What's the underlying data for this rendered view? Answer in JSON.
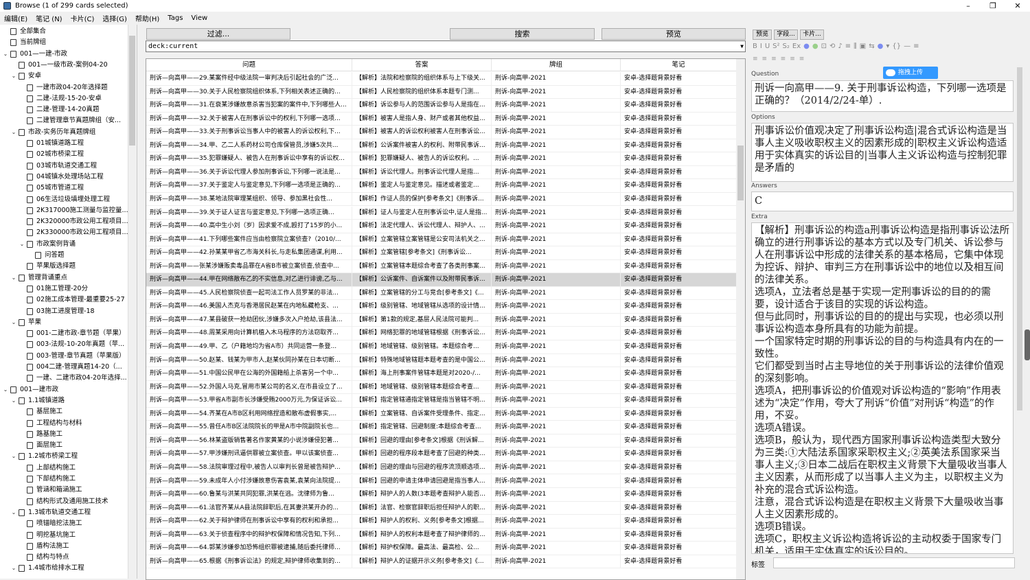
{
  "window": {
    "title": "Browse (1 of 299 cards selected)",
    "controls": [
      "–",
      "❐",
      "✕"
    ]
  },
  "menu": [
    "编辑(E)",
    "笔记 (N)",
    "卡片(C)",
    "选择(G)",
    "帮助(H)",
    "Tags",
    "View"
  ],
  "sidebar": [
    {
      "d": 0,
      "exp": "",
      "label": "全部集合",
      "icon": "stack"
    },
    {
      "d": 0,
      "exp": "",
      "label": "当前牌组",
      "icon": "card"
    },
    {
      "d": 0,
      "exp": "v",
      "label": "001—一建-市政",
      "icon": "card"
    },
    {
      "d": 1,
      "exp": "",
      "label": "001—一级市政-案例04-20",
      "icon": "card"
    },
    {
      "d": 1,
      "exp": "v",
      "label": "安卓",
      "icon": "card"
    },
    {
      "d": 2,
      "exp": "",
      "label": "一建市政04-20年选择题",
      "icon": "card"
    },
    {
      "d": 2,
      "exp": "",
      "label": "二建-法规-15-20-安卓",
      "icon": "card"
    },
    {
      "d": 2,
      "exp": "",
      "label": "二建-管理-14-20真题",
      "icon": "card"
    },
    {
      "d": 2,
      "exp": "",
      "label": "二建管理章节真题牌组（安...",
      "icon": "card"
    },
    {
      "d": 1,
      "exp": "v",
      "label": "市政-实务历年真题牌组",
      "icon": "card"
    },
    {
      "d": 2,
      "exp": "",
      "label": "01城镇道路工程",
      "icon": "card"
    },
    {
      "d": 2,
      "exp": "",
      "label": "02城市桥梁工程",
      "icon": "card"
    },
    {
      "d": 2,
      "exp": "",
      "label": "03城市轨道交通工程",
      "icon": "card"
    },
    {
      "d": 2,
      "exp": "",
      "label": "04城镇水处理场站工程",
      "icon": "card"
    },
    {
      "d": 2,
      "exp": "",
      "label": "05城市管道工程",
      "icon": "card"
    },
    {
      "d": 2,
      "exp": "",
      "label": "06生活垃圾填埋处理工程",
      "icon": "card"
    },
    {
      "d": 2,
      "exp": "",
      "label": "2K317000施工测量与监控量...",
      "icon": "card"
    },
    {
      "d": 2,
      "exp": "",
      "label": "2K320000市政公用工程项目...",
      "icon": "card"
    },
    {
      "d": 2,
      "exp": "",
      "label": "2K330000市政公用工程项目...",
      "icon": "card"
    },
    {
      "d": 2,
      "exp": "v",
      "label": "市政案例背诵",
      "icon": "card"
    },
    {
      "d": 3,
      "exp": "",
      "label": "问答题",
      "icon": "card"
    },
    {
      "d": 2,
      "exp": "",
      "label": "苹果版选择题",
      "icon": "card"
    },
    {
      "d": 1,
      "exp": "v",
      "label": "管理背诵重点",
      "icon": "card"
    },
    {
      "d": 2,
      "exp": "",
      "label": "01施工管理-20分",
      "icon": "card"
    },
    {
      "d": 2,
      "exp": "",
      "label": "02施工成本管理-最重要25-27",
      "icon": "card"
    },
    {
      "d": 2,
      "exp": "",
      "label": "03施工进度管理-18",
      "icon": "card"
    },
    {
      "d": 1,
      "exp": "v",
      "label": "苹果",
      "icon": "card"
    },
    {
      "d": 2,
      "exp": "",
      "label": "001-二建市政-章节题（苹果）",
      "icon": "card"
    },
    {
      "d": 2,
      "exp": "",
      "label": "003-法规-10-20年真题（苹...",
      "icon": "card"
    },
    {
      "d": 2,
      "exp": "",
      "label": "003-管理-章节真题（苹果版）",
      "icon": "card"
    },
    {
      "d": 2,
      "exp": "",
      "label": "004二建-管理真题14-20（...",
      "icon": "card"
    },
    {
      "d": 2,
      "exp": "",
      "label": "一建、二建市政04-20年选择...",
      "icon": "card"
    },
    {
      "d": 0,
      "exp": "v",
      "label": "001—建市政",
      "icon": "card"
    },
    {
      "d": 1,
      "exp": "v",
      "label": "1.1城镇道路",
      "icon": "card"
    },
    {
      "d": 2,
      "exp": "",
      "label": "基层施工",
      "icon": "card"
    },
    {
      "d": 2,
      "exp": "",
      "label": "工程结构与材料",
      "icon": "card"
    },
    {
      "d": 2,
      "exp": "",
      "label": "路基施工",
      "icon": "card"
    },
    {
      "d": 2,
      "exp": "",
      "label": "面层施工",
      "icon": "card"
    },
    {
      "d": 1,
      "exp": "v",
      "label": "1.2城市桥梁工程",
      "icon": "card"
    },
    {
      "d": 2,
      "exp": "",
      "label": "上部结构施工",
      "icon": "card"
    },
    {
      "d": 2,
      "exp": "",
      "label": "下部结构施工",
      "icon": "card"
    },
    {
      "d": 2,
      "exp": "",
      "label": "管涵和箱涵施工",
      "icon": "card"
    },
    {
      "d": 2,
      "exp": "",
      "label": "结构形式及通用施工技术",
      "icon": "card"
    },
    {
      "d": 1,
      "exp": "v",
      "label": "1.3城市轨道交通工程",
      "icon": "card"
    },
    {
      "d": 2,
      "exp": "",
      "label": "喷锚暗挖法施工",
      "icon": "card"
    },
    {
      "d": 2,
      "exp": "",
      "label": "明挖基坑施工",
      "icon": "card"
    },
    {
      "d": 2,
      "exp": "",
      "label": "盾构法施工",
      "icon": "card"
    },
    {
      "d": 2,
      "exp": "",
      "label": "结构与特点",
      "icon": "card"
    },
    {
      "d": 1,
      "exp": "v",
      "label": "1.4城市给排水工程",
      "icon": "card"
    }
  ],
  "toolbar": {
    "filter": "过滤...",
    "search": "搜索",
    "preview": "预览"
  },
  "search": {
    "value": "deck:current"
  },
  "grid": {
    "columns": [
      "问题",
      "答案",
      "牌组",
      "笔记"
    ],
    "selected_index": 15,
    "rows": [
      [
        "刑诉—向高甲——29.某案件经中级法院一审判决后引起社会的广泛...",
        "【解析】法院和检察院的组织体系与上下级关...",
        "刑诉-向高甲-2021",
        "安卓-选择题背景好看"
      ],
      [
        "刑诉—向高甲——30.关于人民检察院组织体系,下列相关表述正确的...",
        "【解析】人民检察院的组织体系本题专门测...",
        "刑诉-向高甲-2021",
        "安卓-选择题背景好看"
      ],
      [
        "刑诉—向高甲——31.在衰某涉嫌故意杀害当犯案的案件中,下列哪些人...",
        "【解析】诉讼参与人的范围诉讼参与人是指在...",
        "刑诉-向高甲-2021",
        "安卓-选择题背景好看"
      ],
      [
        "刑诉—向高甲——32.关于被害人在刑事诉讼中的权利,下列哪一选项...",
        "【解析】被害人是指人身、财产或者其他权益...",
        "刑诉-向高甲-2021",
        "安卓-选择题背景好看"
      ],
      [
        "刑诉—向高甲——33.关于刑事诉讼当事人中的被害人的诉讼权利,下...",
        "【解析】被害人的诉讼权利被害人在刑事诉讼...",
        "刑诉-向高甲-2021",
        "安卓-选择题背景好看"
      ],
      [
        "刑诉—向高甲——34.甲、乙二人系药材公司仓库保管员,涉嫌5次共...",
        "【解析】公诉案件被害人的权利、附带民事诉...",
        "刑诉-向高甲-2021",
        "安卓-选择题背景好看"
      ],
      [
        "刑诉—向高甲——35.犯罪嫌疑人、被告人在刑事诉讼中享有的诉讼权...",
        "【解析】犯罪嫌疑人、被告人的诉讼权利。...",
        "刑诉-向高甲-2021",
        "安卓-选择题背景好看"
      ],
      [
        "刑诉—向高甲——36.关于诉讼代理人参加刑事诉讼,下列哪一说法是...",
        "【解析】诉讼代理人。刑事诉讼代理人是指...",
        "刑诉-向高甲-2021",
        "安卓-选择题背景好看"
      ],
      [
        "刑诉—向高甲——37.关于鉴定人与鉴定意见,下列哪一选项是正确的...",
        "【解析】鉴定人与鉴定意见。描述或者鉴定...",
        "刑诉-向高甲-2021",
        "安卓-选择题背景好看"
      ],
      [
        "刑诉—向高甲——38.某地法院审理某组织、领导、参加黑社会性...",
        "【解析】作证人员的保护[参考条文]《刑事诉...",
        "刑诉-向高甲-2021",
        "安卓-选择题背景好看"
      ],
      [
        "刑诉—向高甲——39.关于证人证言与鉴定意见,下列哪一选项正确...",
        "【解析】证人与鉴定人在刑事诉讼中,证人是指...",
        "刑诉-向高甲-2021",
        "安卓-选择题背景好看"
      ],
      [
        "刑诉—向高甲——40.高中生小刘（岁）因求爱不成,殴打了15岁的小...",
        "【解析】法定代理人、诉讼代理人、辩护人、...",
        "刑诉-向高甲-2021",
        "安卓-选择题背景好看"
      ],
      [
        "刑诉—向高甲——41.下列哪些案件应当由检察院立案侦查?（2010/...",
        "【解析】立案管辖立案管辖是公安司法机关之...",
        "刑诉-向高甲-2021",
        "安卓-选择题背景好看"
      ],
      [
        "刑诉—向高甲——42.孙某某甲省乙市海关科长,与走私集团通谋,利用...",
        "【解析】立案管辖[参考条文]《刑事诉讼...",
        "刑诉-向高甲-2021",
        "安卓-选择题背景好看"
      ],
      [
        "刑诉—向高甲——张某涉嫌贩卖毒品罪在A省B市被立案侦查,侦查中...",
        "【解析】立案管辖本题综合考查了各类刑事案...",
        "刑诉-向高甲-2021",
        "安卓-选择题背景好看"
      ],
      [
        "刑诉—向高甲——44.甲在网络散布乙的不实信息,对乙进行诽谤,乙与...",
        "【解析】公诉案件、自诉案件以及附带民事诉...",
        "刑诉-向高甲-2021",
        "安卓-选择题背景好看"
      ],
      [
        "刑诉—向高甲——45.人民检察院侦查一起司法工作人员罗某的非法...",
        "【解析】立案管辖的分工与竞合[参考条文]《...",
        "刑诉-向高甲-2021",
        "安卓-选择题背景好看"
      ],
      [
        "刑诉—向高甲——46.美国人杰克与香港居民赵某在内地私藏枪支、...",
        "【解析】级别管辖、地域管辖从选项的设计情...",
        "刑诉-向高甲-2021",
        "安卓-选择题背景好看"
      ],
      [
        "刑诉—向高甲——47.某县破获一抢劫团伙,涉嫌多次入户抢劫,该县法...",
        "【解析】第1款的规定,基层人民法院可能判...",
        "刑诉-向高甲-2021",
        "安卓-选择题背景好看"
      ],
      [
        "刑诉—向高甲——48.周某采用向计算机植入木马程序的方法窃取齐...",
        "【解析】网络犯罪的地域管辖根据《刑事诉讼...",
        "刑诉-向高甲-2021",
        "安卓-选择题背景好看"
      ],
      [
        "刑诉—向高甲——49.甲、乙（户籍地均为省A市）共同运营一条登...",
        "【解析】地域管辖、级别管辖。本题综合考...",
        "刑诉-向高甲-2021",
        "安卓-选择题背景好看"
      ],
      [
        "刑诉—向高甲——50.赵某、钱某为甲市人,赵某伙同孙某在日本切断...",
        "【解析】特殊地域管辖题本题考查的是中国公...",
        "刑诉-向高甲-2021",
        "安卓-选择题背景好看"
      ],
      [
        "刑诉—向高甲——51.中国公民甲在公海的外国籍船上杀害另一个中...",
        "【解析】海上刑事案件管辖本题是对2020-/...",
        "刑诉-向高甲-2021",
        "安卓-选择题背景好看"
      ],
      [
        "刑诉—向高甲——52.外国人马克,冒用市某公司的名义,在市县设立了...",
        "【解析】地域管辖、级别管辖本题综合考查...",
        "刑诉-向高甲-2021",
        "安卓-选择题背景好看"
      ],
      [
        "刑诉—向高甲——53.甲省A市副市长涉嫌受贿2000万元,为保证诉讼...",
        "【解析】指定管辖通指定管辖是指当管辖不明...",
        "刑诉-向高甲-2021",
        "安卓-选择题背景好看"
      ],
      [
        "刑诉—向高甲——54.齐某在A市B区利用网络捏造和散布虚假事实,...",
        "【解析】立案管辖、自诉案件受理条件、指定...",
        "刑诉-向高甲-2021",
        "安卓-选择题背景好看"
      ],
      [
        "刑诉—向高甲——55.曾任A市B区法院院长的甲是A市中院副院长也...",
        "【解析】指定管辖、回避制度:本题综合考查...",
        "刑诉-向高甲-2021",
        "安卓-选择题背景好看"
      ],
      [
        "刑诉—向高甲——56.林某盗版销售著名作家黄某的小说涉嫌侵犯著...",
        "【解析】回避的理由[参考条文]根据《刑诉解...",
        "刑诉-向高甲-2021",
        "安卓-选择题背景好看"
      ],
      [
        "刑诉—向高甲——57.甲涉嫌刑讯逼供罪被立案侦查。甲以该案侦查...",
        "【解析】回避的程序段本题考查了回避的种类...",
        "刑诉-向高甲-2021",
        "安卓-选择题背景好看"
      ],
      [
        "刑诉—向高甲——58.法院审理过程中,被告人以审判长曾是被告辩护...",
        "【解析】回避的理由与回避的程序流顶顺选项...",
        "刑诉-向高甲-2021",
        "安卓-选择题背景好看"
      ],
      [
        "刑诉—向高甲——59.未成年人小付涉嫌故意伤害袁某,袁某向法院提...",
        "【解析】回避的申请主体申请回避是指当事人...",
        "刑诉-向高甲-2021",
        "安卓-选择题背景好看"
      ],
      [
        "刑诉—向高甲——60.鲁某与洪某共同犯罪,洪某在逃。沈律师为鲁...",
        "【解析】辩护人的人数(3本题考查辩护人能否...",
        "刑诉-向高甲-2021",
        "安卓-选择题背景好看"
      ],
      [
        "刑诉—向高甲——61.法官齐某从A县法院辞职后,在其妻洪某开办的...",
        "【解析】法官、检察官辞职后担任辩护人的职...",
        "刑诉-向高甲-2021",
        "安卓-选择题背景好看"
      ],
      [
        "刑诉—向高甲——62.关于辩护律师在刑事诉讼中享有的权利和承担...",
        "【解析】辩护人的权利、义务[参考条文]根据...",
        "刑诉-向高甲-2021",
        "安卓-选择题背景好看"
      ],
      [
        "刑诉—向高甲——63.关于侦查程序中的辩护权保障和情况告知,下列...",
        "【解析】辩护人的权利本题考查了辩护律师的...",
        "刑诉-向高甲-2021",
        "安卓-选择题背景好看"
      ],
      [
        "刑诉—向高甲——64.郭某涉嫌参加恐怖组织罪被逮捕,随后委托律师...",
        "【解析】辩护权保障。最高法、最高检、公...",
        "刑诉-向高甲-2021",
        "安卓-选择题背景好看"
      ],
      [
        "刑诉—向高甲——65.根据《刑事诉讼法》的规定,辩护律师收集到的...",
        "【解析】辩护人的证据开示义务[参考条文]《...",
        "刑诉-向高甲-2021",
        "安卓-选择题背景好看"
      ]
    ]
  },
  "editor": {
    "buttons": [
      "预览",
      "字段...",
      "卡片..."
    ],
    "format_icons": [
      "B",
      "I",
      "U",
      "S²",
      "S₂",
      "Ex",
      "●",
      "●",
      "⊡",
      "⟲",
      "♪",
      "≡",
      "⫼",
      "▣",
      "⇆",
      "●",
      "▾",
      "{}",
      "—",
      "≡"
    ],
    "upload_label": "拖拽上传",
    "fields": [
      {
        "name": "Question",
        "text": "刑诉一向高甲——9. 关于刑事诉讼构造，下列哪一选项是正确的？（2014/2/24-单）."
      },
      {
        "name": "Options",
        "text": "刑事诉讼价值观决定了刑事诉讼构造|混合式诉讼构造是当事人主义吸收职权主义的因素形成的|职权主义诉讼构造适用于实体真实的诉讼目的|当事人主义诉讼构造与控制犯罪是矛盾的"
      },
      {
        "name": "Answers",
        "text": "C"
      },
      {
        "name": "Extra",
        "text": "【解析】刑事诉讼的构造a刑事诉讼构造是指刑事诉讼法所确立的进行刑事诉讼的基本方式以及专门机关、诉讼参与人在刑事诉讼中形成的法律关系的基本格局，它集中体现为控诉、辩护、审判三方在刑事诉讼中的地位以及相互间的法律关系。\n选项A，立法者总是基于实现一定刑事诉讼的目的的需要，设计适合于该目的实现的诉讼构造。\n但与此同时，刑事诉讼的目的的提出与实现，也必须以刑事诉讼构造本身所具有的功能为前提。\n一个国家特定时期的刑事诉讼的目的与构造具有内在的一致性。\n它们都受到当时占主导地位的关于刑事诉讼的法律价值观的深刻影响。\n选项A，把刑事诉讼的价值观对诉讼构造的“影响”作用表述为“决定”作用，夸大了刑诉“价值”对刑诉“构造”的作用，不妥。\n选项A错误。\n选项B，般认为，现代西方国家刑事诉讼构造类型大致分为三类:①大陆法系国家采职权主义;②英美法系国家采当事人主义;③日本二战后在职权主义背景下大量吸收当事人主义因素，从而形成了以当事人主义为主，以职权主义为补充的混合式诉讼构造。\n注意，混合式诉讼构造是在职权主义背景下大量吸收当事人主义因素形成的。\n选项B错误。\n选项C，职权主义诉讼构造将诉讼的主动权委于国家专门机关，适用于实体真实的诉讼目的。"
      }
    ],
    "tags_label": "标签"
  }
}
